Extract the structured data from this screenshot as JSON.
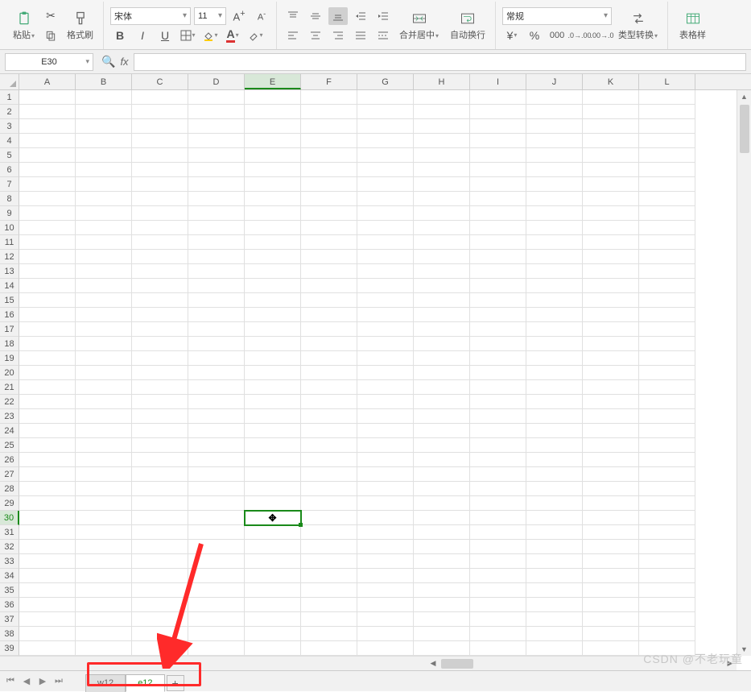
{
  "ribbon": {
    "paste_label": "粘贴",
    "format_painter_label": "格式刷",
    "font_name": "宋体",
    "font_size": "11",
    "merge_center_label": "合并居中",
    "wrap_text_label": "自动换行",
    "number_format": "常规",
    "type_convert_label": "类型转换",
    "table_style_label": "表格样"
  },
  "formula_bar": {
    "cell_ref": "E30",
    "fx_symbol": "fx"
  },
  "grid": {
    "columns": [
      "A",
      "B",
      "C",
      "D",
      "E",
      "F",
      "G",
      "H",
      "I",
      "J",
      "K",
      "L"
    ],
    "row_count": 39,
    "selected_col_index": 4,
    "selected_row": 30
  },
  "sheets": {
    "tabs": [
      {
        "name": "w12",
        "active": false
      },
      {
        "name": "e12",
        "active": true
      }
    ],
    "add_label": "+"
  },
  "watermark": "CSDN @不老玩童",
  "icons": {
    "cut": "✂",
    "bold": "B",
    "italic": "I",
    "underline": "U",
    "currency": "¥",
    "percent": "%"
  }
}
